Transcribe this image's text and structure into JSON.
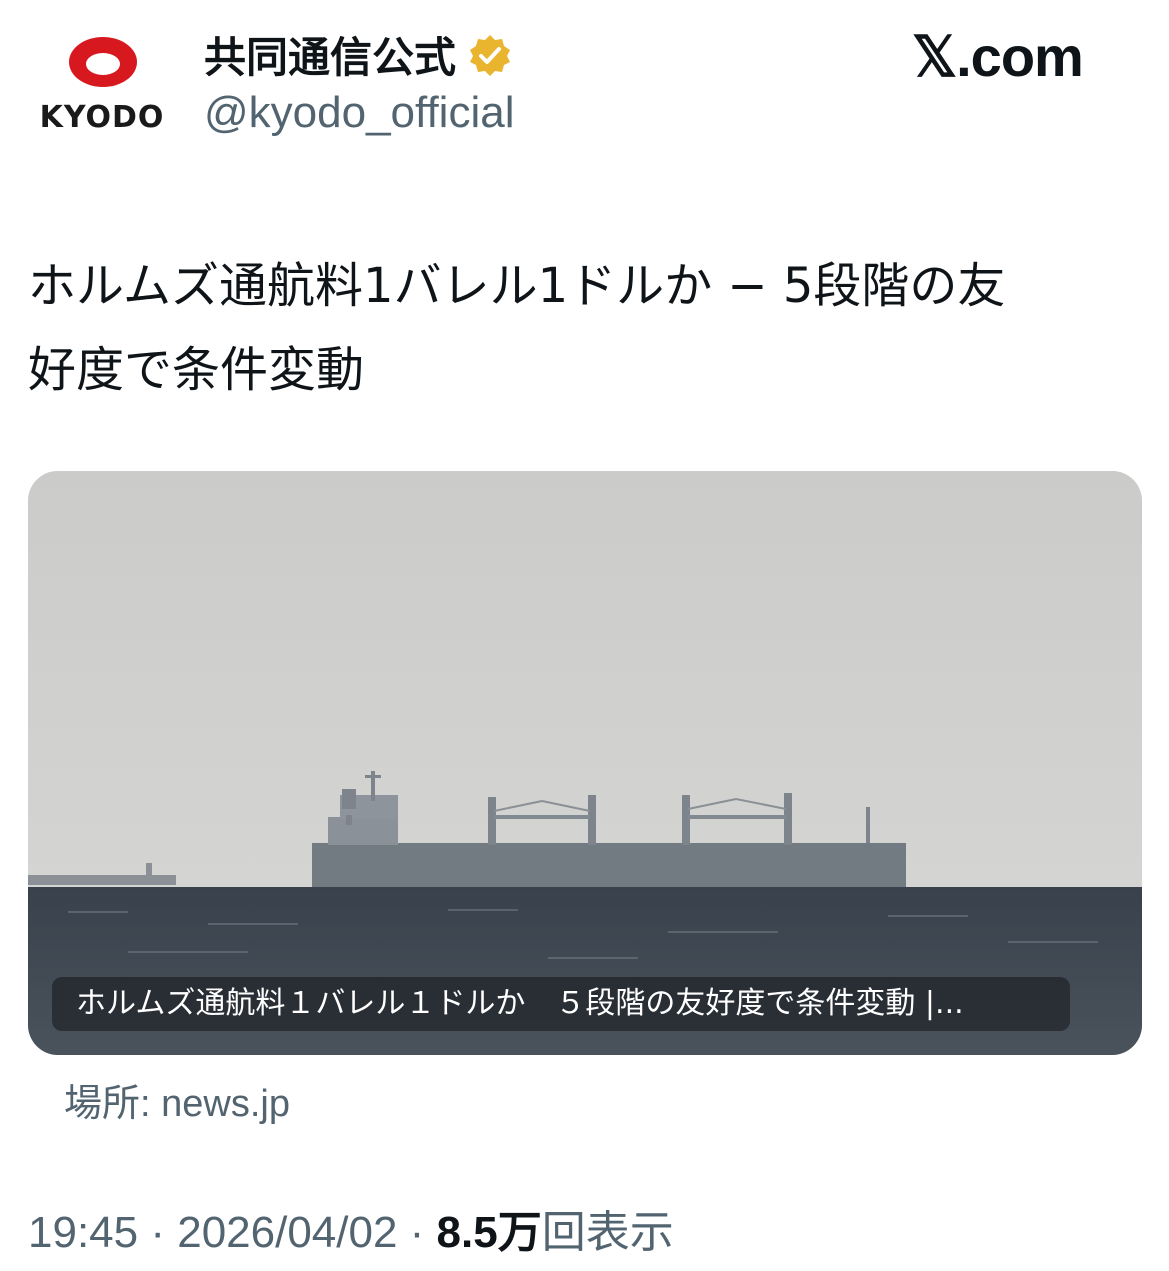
{
  "account": {
    "logo_text": "KYODO",
    "name": "共同通信公式",
    "handle": "@kyodo_official",
    "verified_color": "#E9B52E"
  },
  "brand": {
    "site": "𝕏.com"
  },
  "tweet": {
    "text_line1": "ホルムズ通航料1バレル1ドルか − 5段階の友",
    "text_line2": "好度で条件変動"
  },
  "card": {
    "caption": "ホルムズ通航料１バレル１ドルか　５段階の友好度で条件変動 |...",
    "source_label": "場所: ",
    "source_domain": "news.jp"
  },
  "meta": {
    "time": "19:45",
    "separator1": " · ",
    "date": "2026/04/02",
    "separator2": " · ",
    "views_count": "8.5万",
    "views_label": "回表示"
  },
  "colors": {
    "logo_red": "#D7191F",
    "secondary_text": "#536471"
  }
}
